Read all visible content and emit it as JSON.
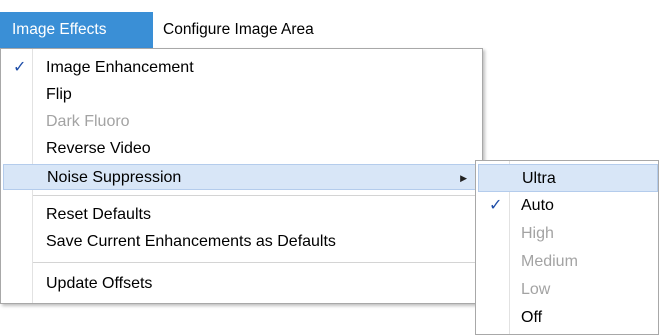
{
  "header_text": "Image Effects Configure Image Area (partial, cut off)",
  "menubar": {
    "active_tab": "Image Effects",
    "other_tab": "Configure Image Area"
  },
  "menu": {
    "items": [
      {
        "label": "Image Enhancement",
        "checked": true,
        "disabled": false
      },
      {
        "label": "Flip",
        "checked": false,
        "disabled": false
      },
      {
        "label": "Dark Fluoro",
        "checked": false,
        "disabled": true
      },
      {
        "label": "Reverse Video",
        "checked": false,
        "disabled": false
      },
      {
        "label": "Noise Suppression",
        "checked": false,
        "disabled": false,
        "has_submenu": true,
        "highlighted": true
      },
      {
        "label": "Reset Defaults",
        "checked": false,
        "disabled": false
      },
      {
        "label": "Save Current Enhancements as Defaults",
        "checked": false,
        "disabled": false
      },
      {
        "label": "Update Offsets",
        "checked": false,
        "disabled": false
      }
    ],
    "check_glyph": "✓",
    "submenu_arrow": "▶"
  },
  "submenu": {
    "items": [
      {
        "label": "Ultra",
        "checked": false,
        "disabled": false,
        "highlighted": true
      },
      {
        "label": "Auto",
        "checked": true,
        "disabled": false
      },
      {
        "label": "High",
        "checked": false,
        "disabled": true
      },
      {
        "label": "Medium",
        "checked": false,
        "disabled": true
      },
      {
        "label": "Low",
        "checked": false,
        "disabled": true
      },
      {
        "label": "Off",
        "checked": false,
        "disabled": false
      }
    ]
  },
  "colors": {
    "active_tab_bg": "#3a8fd6",
    "highlight_bg": "#d8e6f7",
    "disabled_text": "#a3a3a3",
    "check": "#1f4ea8"
  }
}
